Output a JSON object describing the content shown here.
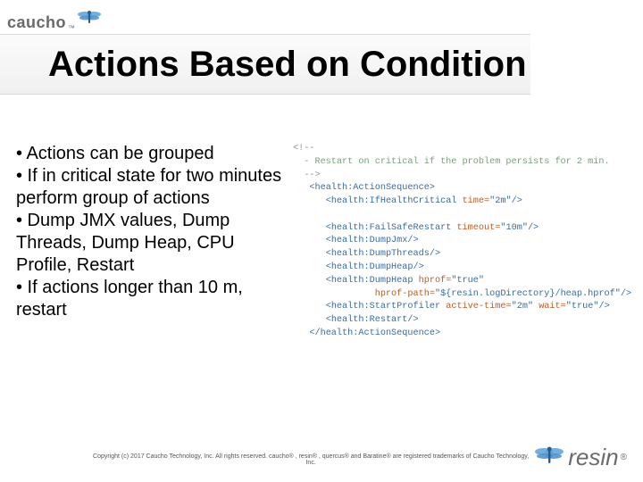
{
  "header": {
    "logo_text": "caucho",
    "logo_tm": "™"
  },
  "title": "Actions Based on Condition",
  "bullets": [
    "• Actions can be grouped",
    "• If in critical state for two minutes perform group of actions",
    "• Dump JMX values, Dump Threads, Dump Heap, CPU Profile, Restart",
    "• If actions longer than 10 m, restart"
  ],
  "code": {
    "comment_open": "<!--",
    "comment_line": "  - Restart on critical if the problem persists for 2 min.",
    "comment_close": "  -->",
    "lines": [
      {
        "indent": 1,
        "open": true,
        "tag": "health:ActionSequence",
        "attrs": []
      },
      {
        "indent": 2,
        "self": true,
        "tag": "health:IfHealthCritical",
        "attrs": [
          [
            "time",
            "2m"
          ]
        ]
      },
      {
        "indent": 0,
        "blank": true
      },
      {
        "indent": 2,
        "self": true,
        "tag": "health:FailSafeRestart",
        "attrs": [
          [
            "timeout",
            "10m"
          ]
        ]
      },
      {
        "indent": 2,
        "self": true,
        "tag": "health:DumpJmx",
        "attrs": []
      },
      {
        "indent": 2,
        "self": true,
        "tag": "health:DumpThreads",
        "attrs": []
      },
      {
        "indent": 2,
        "self": true,
        "tag": "health:DumpHeap",
        "attrs": []
      },
      {
        "indent": 2,
        "cont": true,
        "tag": "health:DumpHeap",
        "attrs": [
          [
            "hprof",
            "true"
          ]
        ],
        "tail_attrs": [
          [
            "hprof-path",
            "${resin.logDirectory}/heap.hprof"
          ]
        ]
      },
      {
        "indent": 2,
        "self": true,
        "tag": "health:StartProfiler",
        "attrs": [
          [
            "active-time",
            "2m"
          ],
          [
            "wait",
            "true"
          ]
        ]
      },
      {
        "indent": 2,
        "self": true,
        "tag": "health:Restart",
        "attrs": []
      },
      {
        "indent": 1,
        "close": true,
        "tag": "health:ActionSequence"
      }
    ]
  },
  "footer": {
    "copyright": "Copyright (c) 2017 Caucho Technology, Inc. All rights reserved. caucho® , resin® , quercus® and Baratine® are registered trademarks of Caucho Technology, Inc.",
    "resin_text": "resin",
    "reg": "®"
  }
}
